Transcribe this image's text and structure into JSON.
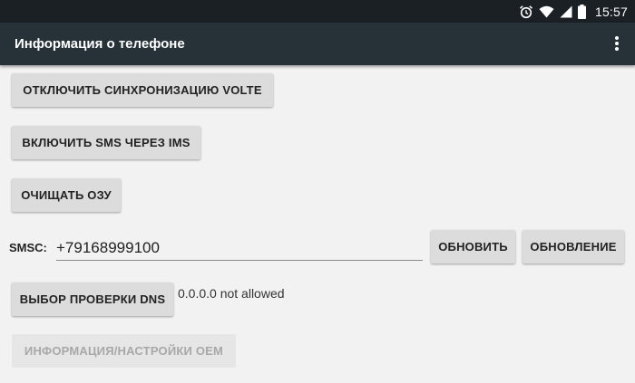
{
  "status_bar": {
    "time": "15:57",
    "icons": [
      "alarm-icon",
      "wifi-icon",
      "cell-signal-icon",
      "battery-icon"
    ]
  },
  "app_bar": {
    "title": "Информация о телефоне",
    "menu_icon": "overflow-menu-icon"
  },
  "buttons": {
    "volte_sync": "ОТКЛЮЧИТЬ СИНХРОНИЗАЦИЮ VOLTE",
    "sms_over_ims": "ВКЛЮЧИТЬ SMS ЧЕРЕЗ IMS",
    "clear_ram": "ОЧИЩАТЬ ОЗУ",
    "refresh": "ОБНОВИТЬ",
    "update": "ОБНОВЛЕНИЕ",
    "dns_check": "ВЫБОР ПРОВЕРКИ DNS",
    "oem_info": "ИНФОРМАЦИЯ/НАСТРОЙКИ OEM"
  },
  "smsc": {
    "label": "SMSC:",
    "value": "+79168999100"
  },
  "dns_status": "0.0.0.0 not allowed",
  "colors": {
    "status_bar": "#1a2023",
    "app_bar": "#263238",
    "background": "#f2f2f2",
    "button": "#dcdcdc"
  }
}
